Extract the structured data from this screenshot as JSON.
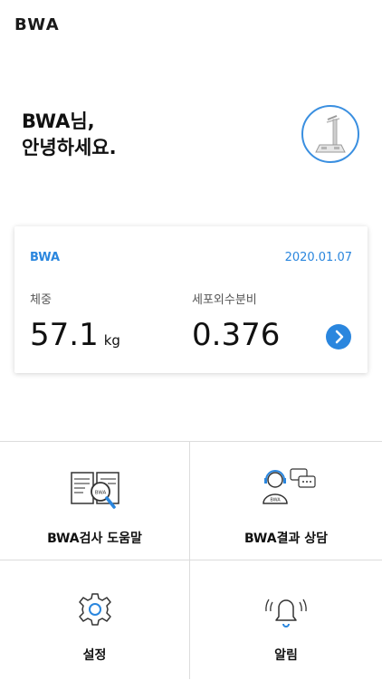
{
  "app": {
    "logo": "BWA"
  },
  "greeting": {
    "line1": "BWA님,",
    "line2": "안녕하세요."
  },
  "card": {
    "brand": "BWA",
    "date": "2020.01.07",
    "weight": {
      "label": "체중",
      "value": "57.1",
      "unit": "kg"
    },
    "ecw_ratio": {
      "label": "세포외수분비",
      "value": "0.376"
    }
  },
  "menu": {
    "guide": "BWA검사 도움말",
    "consult": "BWA결과 상담",
    "consult_badge": "BWA",
    "settings": "설정",
    "alerts": "알림"
  },
  "colors": {
    "accent": "#2a86de"
  }
}
